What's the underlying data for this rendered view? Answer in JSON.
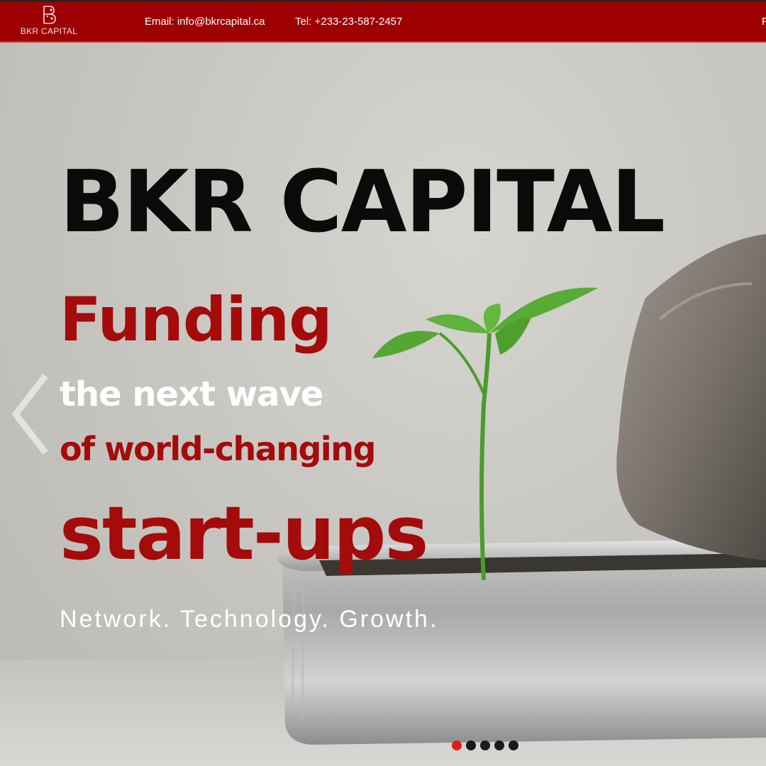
{
  "header": {
    "logo_text": "BKR CAPITAL",
    "email": "Email: info@bkrcapital.ca",
    "tel": "Tel: +233-23-587-2457",
    "nav_edge": "P"
  },
  "hero": {
    "title": "BKR CAPITAL",
    "line1": "Funding",
    "line2": "the next wave",
    "line3": "of world-changing",
    "line4": "start-ups",
    "tagline": "Network. Technology. Growth."
  },
  "slider": {
    "slide_count": 5,
    "active_index": 0
  },
  "colors": {
    "brand_red": "#9d0000",
    "headline_red": "#a40b0b",
    "active_dot": "#e21b1b"
  },
  "icons": {
    "prev": "chevron-left-icon",
    "logo": "bkr-monogram-logo"
  }
}
